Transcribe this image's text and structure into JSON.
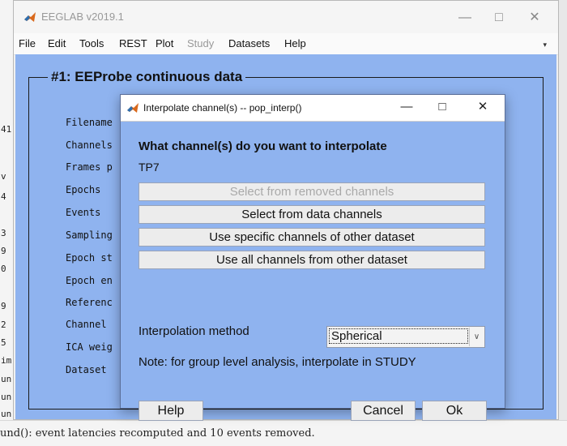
{
  "console": {
    "left_chars": [
      "41",
      "v",
      "4",
      "3",
      "9",
      "0",
      "9",
      "2",
      "5",
      "im",
      "un",
      "un",
      "un"
    ],
    "bottom_line": "und(): event latencies recomputed and 10 events removed."
  },
  "main_window": {
    "title": "EEGLAB v2019.1",
    "menu": [
      "File",
      "Edit",
      "Tools",
      "REST",
      "Plot",
      "Study",
      "Datasets",
      "Help"
    ],
    "disabled_menu": "Study",
    "dataset_title": "#1: EEProbe continuous data",
    "field_labels": [
      "Filename",
      "Channels",
      "Frames p",
      "Epochs",
      "Events",
      "Sampling",
      "Epoch st",
      "Epoch en",
      "Referenc",
      "Channel",
      "ICA weig",
      "Dataset"
    ]
  },
  "dialog": {
    "title": "Interpolate channel(s) -- pop_interp()",
    "question": "What channel(s) do you want to interpolate",
    "channel": "TP7",
    "buttons": {
      "removed": "Select from removed channels",
      "data": "Select from data channels",
      "specific": "Use specific channels of other dataset",
      "all": "Use all channels from other dataset"
    },
    "interp_label": "Interpolation method",
    "interp_value": "Spherical",
    "note": "Note: for group level analysis, interpolate in STUDY",
    "help_label": "Help",
    "cancel_label": "Cancel",
    "ok_label": "Ok"
  },
  "icons": [
    "matlab-logo-icon",
    "minimize-icon",
    "maximize-icon",
    "close-icon",
    "dropdown-arrow-icon"
  ],
  "colors": {
    "panel": "#8fb3ef"
  }
}
